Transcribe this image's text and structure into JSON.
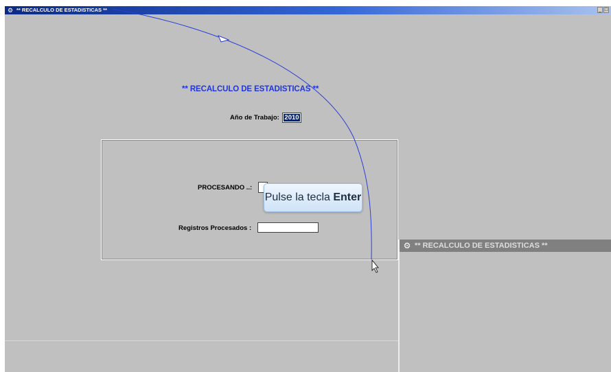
{
  "window": {
    "title": "** RECALCULO DE ESTADISTICAS **",
    "controls": {
      "minimize": "_",
      "maximize": "□"
    }
  },
  "form": {
    "heading": "** RECALCULO DE ESTADISTICAS **",
    "year_label": "Año de Trabajo:",
    "year_value": "2010",
    "processing_label": "PROCESANDO ..:",
    "processing_value": "",
    "records_label": "Registros Procesados :",
    "records_value": ""
  },
  "tooltip": {
    "text": "Pulse la tecla",
    "key": "Enter"
  },
  "secondary_window": {
    "title": "** RECALCULO DE ESTADISTICAS **"
  },
  "icons": {
    "app": "gear-icon",
    "cursor": "mouse-pointer-icon"
  },
  "colors": {
    "heading": "#1f35e0",
    "titlebar": "#0b2a86",
    "background": "#c0c0c0",
    "selection": "#0a246a"
  }
}
